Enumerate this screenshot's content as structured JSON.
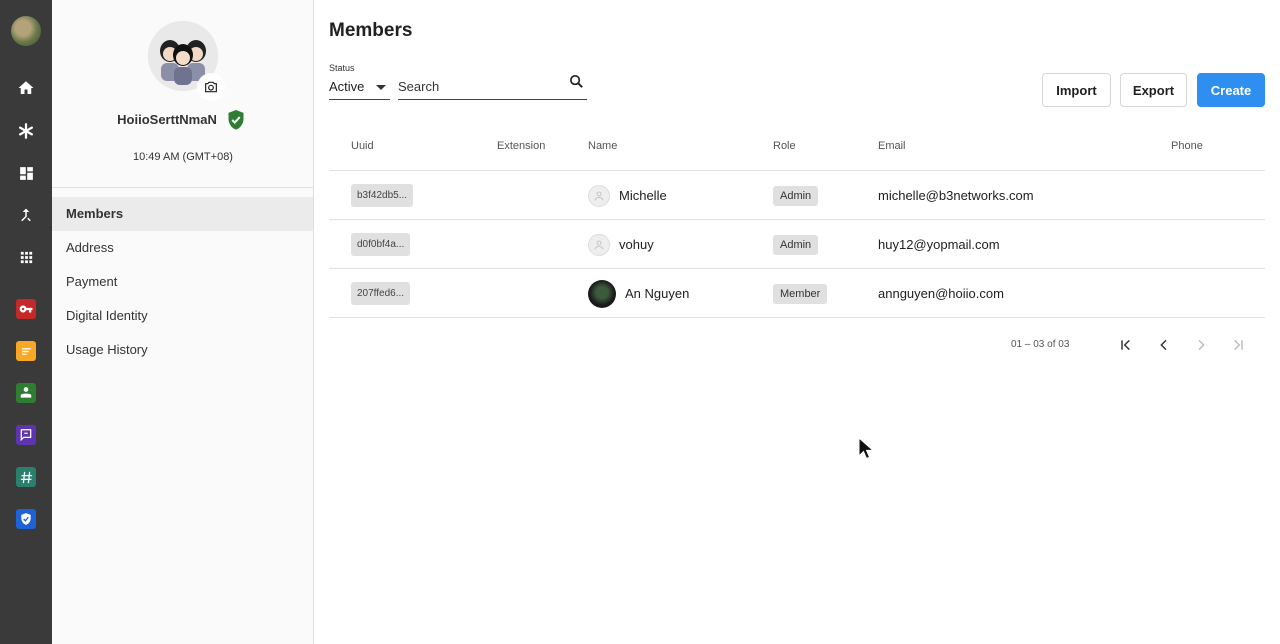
{
  "panel": {
    "org_name": "HoiioSerttNmaN",
    "local_time": "10:49 AM (GMT+08)",
    "nav": [
      {
        "label": "Members",
        "active": true
      },
      {
        "label": "Address",
        "active": false
      },
      {
        "label": "Payment",
        "active": false
      },
      {
        "label": "Digital Identity",
        "active": false
      },
      {
        "label": "Usage History",
        "active": false
      }
    ]
  },
  "main": {
    "title": "Members",
    "status_label": "Status",
    "status_value": "Active",
    "search_placeholder": "Search",
    "import_label": "Import",
    "export_label": "Export",
    "create_label": "Create",
    "columns": [
      "Uuid",
      "Extension",
      "Name",
      "Role",
      "Email",
      "Phone"
    ],
    "rows": [
      {
        "uuid": "b3f42db5...",
        "extension": "",
        "name": "Michelle",
        "role": "Admin",
        "email": "michelle@b3networks.com",
        "phone": "",
        "avatar": "default"
      },
      {
        "uuid": "d0f0bf4a...",
        "extension": "",
        "name": "vohuy",
        "role": "Admin",
        "email": "huy12@yopmail.com",
        "phone": "",
        "avatar": "default"
      },
      {
        "uuid": "207ffed6...",
        "extension": "",
        "name": "An Nguyen",
        "role": "Member",
        "email": "annguyen@hoiio.com",
        "phone": "",
        "avatar": "photo"
      }
    ],
    "pager_range": "01 – 03 of 03"
  },
  "colors": {
    "rail": "#3a3a3a",
    "primary": "#2e8ff0",
    "verified": "#2e7d32",
    "app_red": "#c62828",
    "app_yellow": "#f9a825",
    "app_green": "#2e7d32",
    "app_purple": "#5e35b1",
    "app_teal": "#2a7f6f",
    "app_blue": "#1e62d8"
  }
}
